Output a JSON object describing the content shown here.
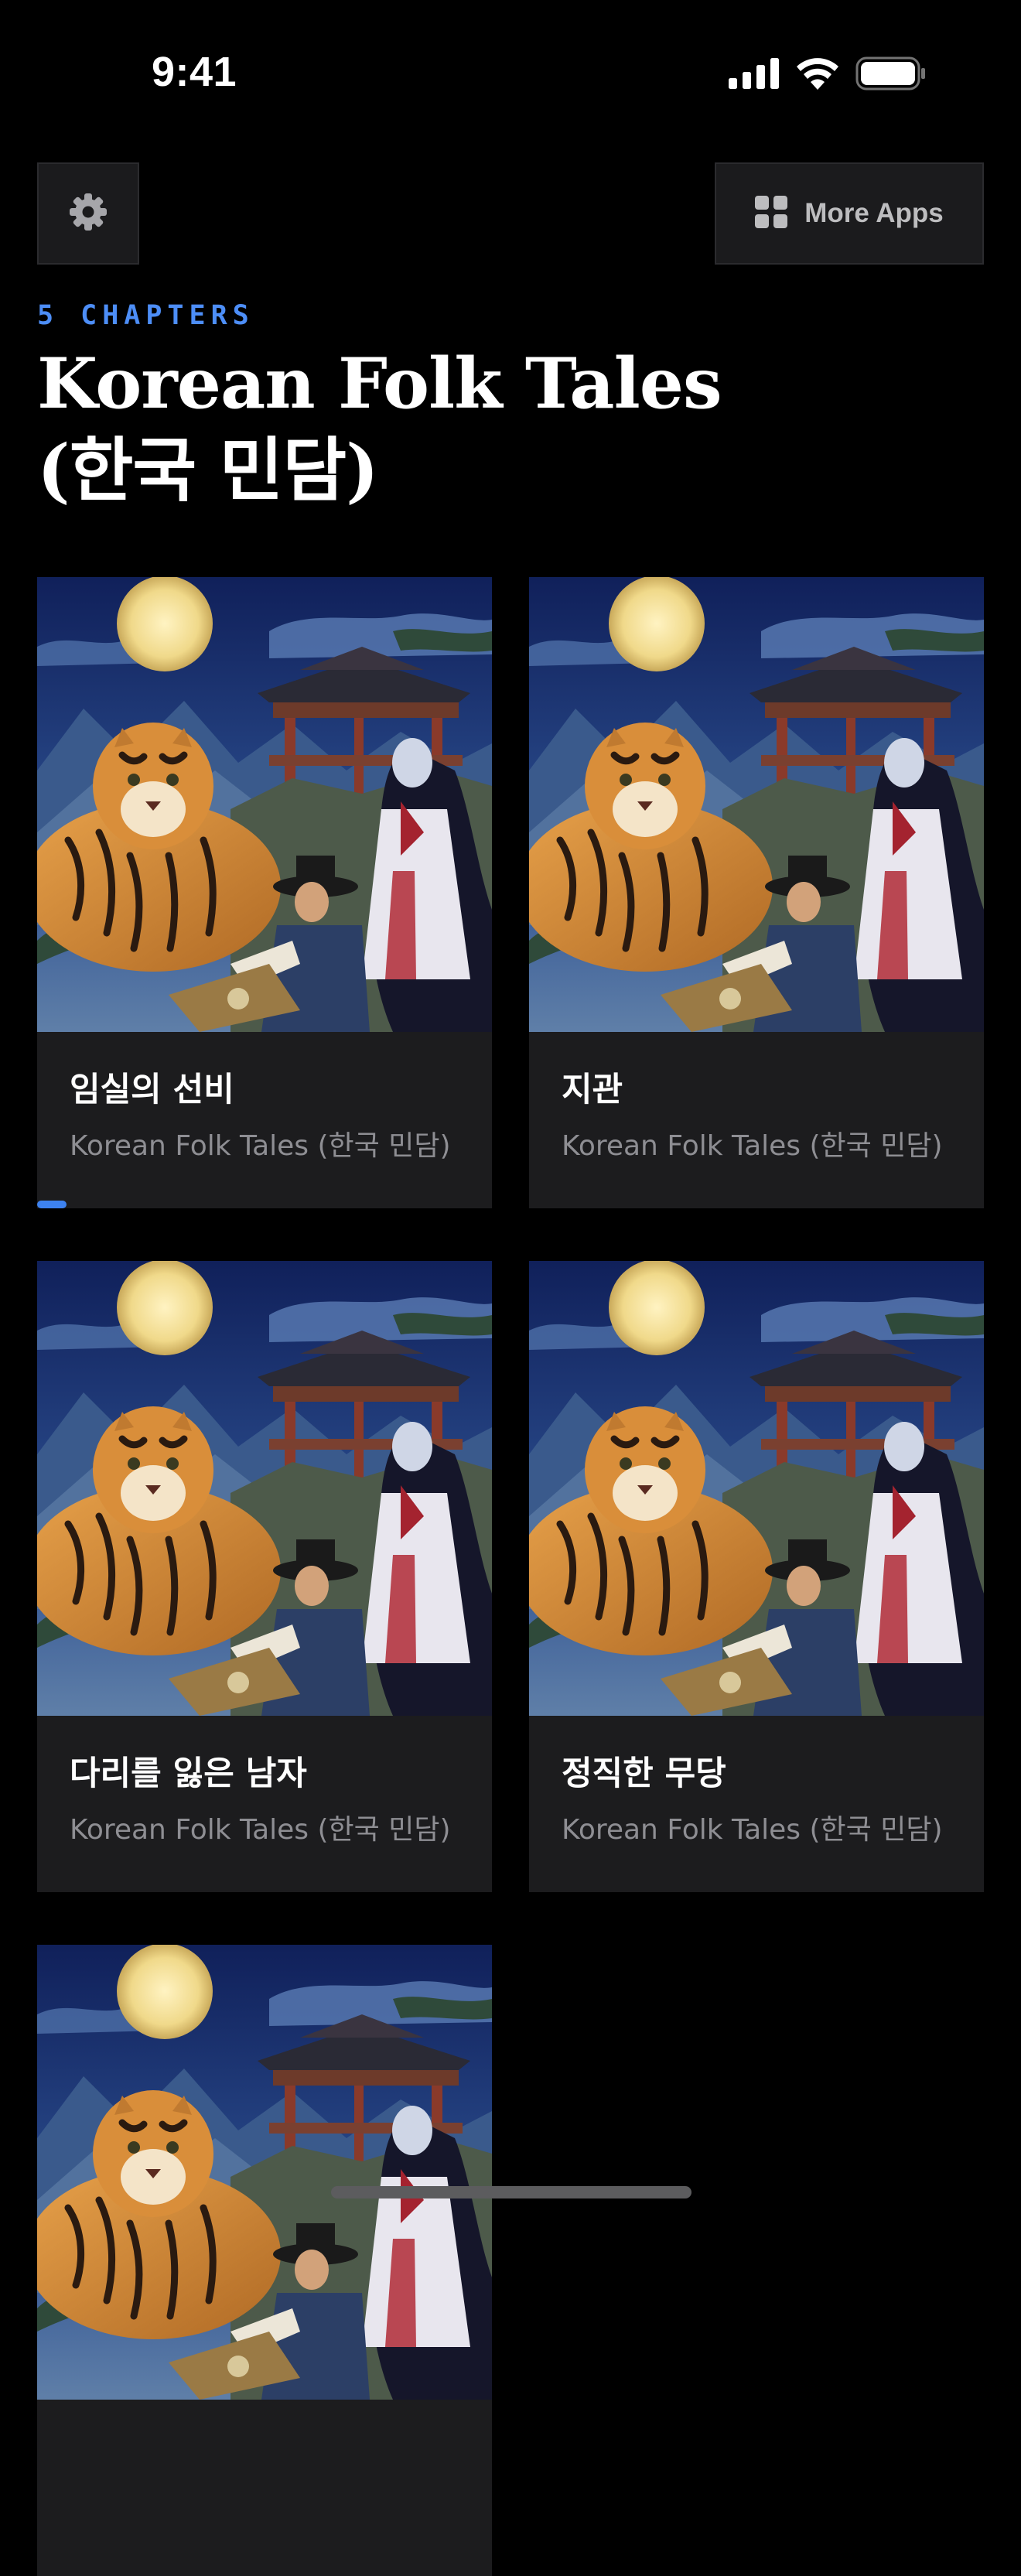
{
  "status_bar": {
    "time": "9:41"
  },
  "toolbar": {
    "settings_icon": "gear-icon",
    "more_apps_icon": "grid-icon",
    "more_apps_label": "More Apps"
  },
  "header": {
    "chapter_count": "5 CHAPTERS",
    "title_line1": "Korean Folk Tales",
    "title_line2": "(한국 민담)"
  },
  "colors": {
    "background": "#000000",
    "card": "#1c1c1e",
    "accent": "#4d8ef7",
    "subtitle": "#8e8e93"
  },
  "chapters": [
    {
      "title": "임실의 선비",
      "subtitle": "Korean Folk Tales (한국 민담)",
      "progress": 0.065
    },
    {
      "title": "지관",
      "subtitle": "Korean Folk Tales (한국 민담)",
      "progress": 0
    },
    {
      "title": "다리를 잃은 남자",
      "subtitle": "Korean Folk Tales (한국 민담)",
      "progress": 0
    },
    {
      "title": "정직한 무당",
      "subtitle": "Korean Folk Tales (한국 민담)",
      "progress": 0
    },
    {
      "title": "",
      "subtitle": "",
      "progress": 0
    }
  ]
}
